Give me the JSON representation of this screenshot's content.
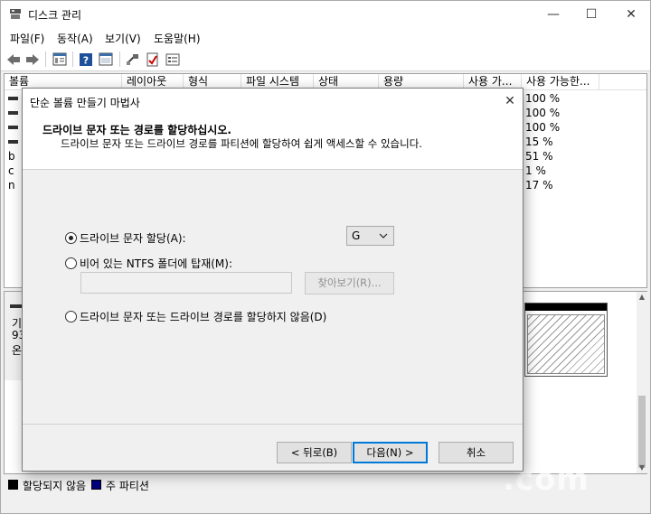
{
  "window": {
    "title": "디스크 관리",
    "controls": {
      "minimize": "—",
      "maximize": "☐",
      "close": "✕"
    }
  },
  "menu": [
    "파일(F)",
    "동작(A)",
    "보기(V)",
    "도움말(H)"
  ],
  "toolbar": {
    "icons": [
      "back-icon",
      "forward-icon",
      "list-view-icon",
      "help-icon",
      "properties-icon",
      "connect-icon",
      "check-icon",
      "settings-icon"
    ]
  },
  "volume_list": {
    "columns": [
      "볼륨",
      "레이아웃",
      "형식",
      "파일 시스템",
      "상태",
      "용량",
      "사용 가...",
      "사용 가능한..."
    ],
    "rows": [
      {
        "vol_prefix": "",
        "percent": "100 %"
      },
      {
        "vol_prefix": "",
        "percent": "100 %"
      },
      {
        "vol_prefix": "",
        "percent": "100 %"
      },
      {
        "vol_prefix": "",
        "percent": "15 %"
      },
      {
        "vol_prefix": "b",
        "percent": "51 %"
      },
      {
        "vol_prefix": "c",
        "percent": "1 %"
      },
      {
        "vol_prefix": "n",
        "percent": "17 %"
      }
    ]
  },
  "disk_panel": {
    "lines": [
      "기",
      "93",
      "온"
    ]
  },
  "legend": [
    {
      "label": "할당되지 않음",
      "color": "#000000"
    },
    {
      "label": "주 파티션",
      "color": "#000080"
    }
  ],
  "dialog": {
    "title": "단순 볼륨 만들기 마법사",
    "close": "✕",
    "heading": "드라이브 문자 또는 경로를 할당하십시오.",
    "subheading": "드라이브 문자 또는 드라이브 경로를 파티션에 할당하여 쉽게 액세스할 수 있습니다.",
    "options": {
      "assign_letter": "드라이브 문자 할당(A):",
      "mount_folder": "비어 있는 NTFS 폴더에 탑재(M):",
      "no_assign": "드라이브 문자 또는 드라이브 경로를 할당하지 않음(D)"
    },
    "selected_option": "assign_letter",
    "drive_letter": "G",
    "folder_path": "",
    "browse_label": "찾아보기(R)...",
    "buttons": {
      "back": "< 뒤로(B)",
      "next": "다음(N) >",
      "cancel": "취소"
    }
  },
  "watermark": ".com"
}
